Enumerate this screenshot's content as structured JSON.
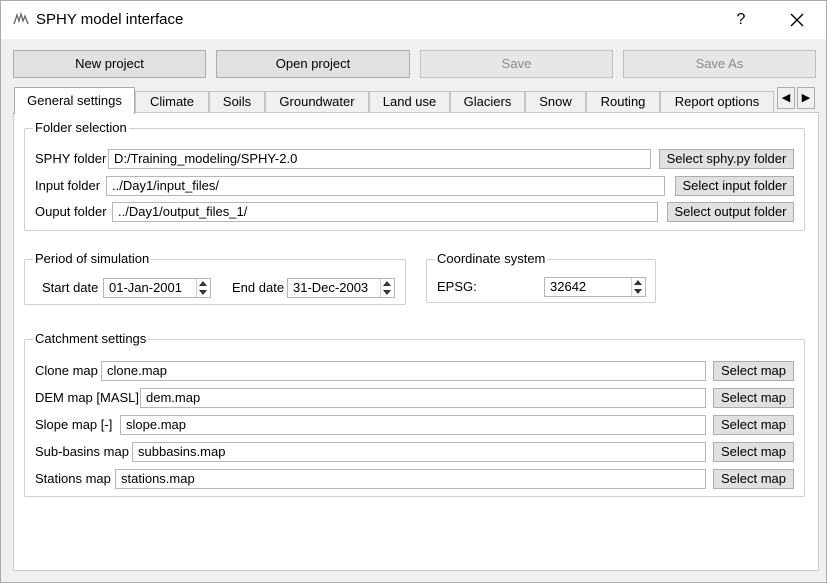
{
  "window": {
    "title": "SPHY model interface",
    "help_label": "?",
    "icons": {
      "app": "sphy-logo-icon",
      "close": "close-icon"
    }
  },
  "toolbar": {
    "new_project": "New project",
    "open_project": "Open project",
    "save": "Save",
    "save_as": "Save As"
  },
  "tabs": [
    {
      "label": "General settings",
      "active": true
    },
    {
      "label": "Climate"
    },
    {
      "label": "Soils"
    },
    {
      "label": "Groundwater"
    },
    {
      "label": "Land use"
    },
    {
      "label": "Glaciers"
    },
    {
      "label": "Snow"
    },
    {
      "label": "Routing"
    },
    {
      "label": "Report options"
    }
  ],
  "tab_scroll": {
    "left": "◀",
    "right": "▶"
  },
  "folder_selection": {
    "title": "Folder selection",
    "sphy": {
      "label": "SPHY folder",
      "value": "D:/Training_modeling/SPHY-2.0",
      "button": "Select sphy.py folder"
    },
    "input": {
      "label": "Input folder",
      "value": "../Day1/input_files/",
      "button": "Select input folder"
    },
    "output": {
      "label": "Ouput folder",
      "value": "../Day1/output_files_1/",
      "button": "Select output folder"
    }
  },
  "period": {
    "title": "Period of simulation",
    "start_label": "Start date",
    "start_value": "01-Jan-2001",
    "end_label": "End date",
    "end_value": "31-Dec-2003"
  },
  "coordinate": {
    "title": "Coordinate system",
    "epsg_label": "EPSG:",
    "epsg_value": "32642"
  },
  "catchment": {
    "title": "Catchment settings",
    "button": "Select map",
    "rows": [
      {
        "label": "Clone map",
        "value": "clone.map"
      },
      {
        "label": "DEM map [MASL]",
        "value": "dem.map"
      },
      {
        "label": "Slope map [-]",
        "value": "slope.map"
      },
      {
        "label": "Sub-basins map",
        "value": "subbasins.map"
      },
      {
        "label": "Stations map",
        "value": "stations.map"
      }
    ]
  }
}
